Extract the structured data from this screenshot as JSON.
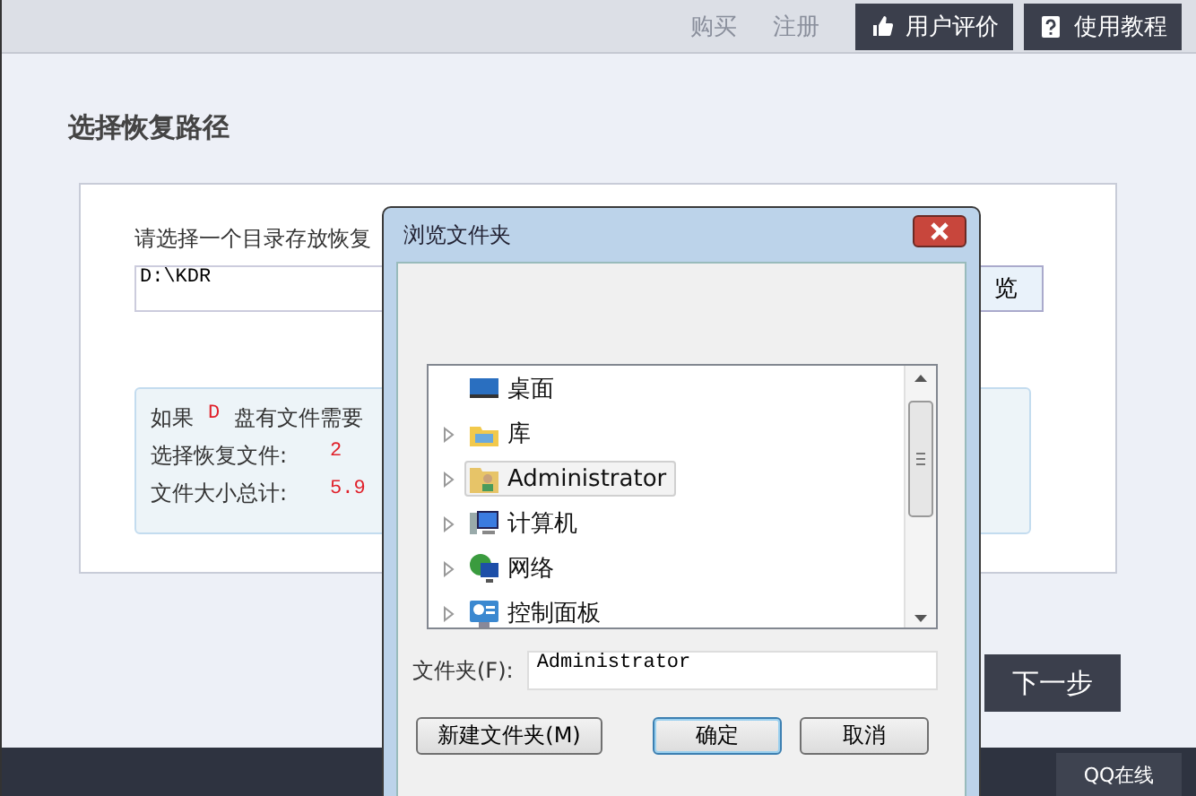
{
  "top_nav": {
    "links": [
      "购买",
      "注册"
    ],
    "buttons": [
      {
        "kind": "thumb",
        "label": "用户评价"
      },
      {
        "kind": "help",
        "label": "使用教程"
      }
    ]
  },
  "page": {
    "title": "选择恢复路径",
    "prompt": "请选择一个目录存放恢复",
    "path_value": "D:\\KDR",
    "browse_label": "览",
    "info": {
      "prefix": "如果",
      "drive": "D",
      "suffix": "盘有文件需要"
    },
    "rows": [
      {
        "label": "选择恢复文件:",
        "value": "2"
      },
      {
        "label": "文件大小总计:",
        "value": "5.9"
      }
    ],
    "next_button": "下一步",
    "qq_button": "QQ在线"
  },
  "dialog": {
    "title": "浏览文件夹",
    "tree": [
      {
        "kind": "desktop",
        "label": "桌面",
        "expandable": false,
        "selected": false
      },
      {
        "kind": "library",
        "label": "库",
        "expandable": true,
        "selected": false
      },
      {
        "kind": "user",
        "label": "Administrator",
        "expandable": true,
        "selected": true
      },
      {
        "kind": "computer",
        "label": "计算机",
        "expandable": true,
        "selected": false
      },
      {
        "kind": "network",
        "label": "网络",
        "expandable": true,
        "selected": false
      },
      {
        "kind": "control_panel",
        "label": "控制面板",
        "expandable": true,
        "selected": false
      }
    ],
    "folder_label": "文件夹(F):",
    "folder_value": "Administrator",
    "buttons": [
      {
        "label": "新建文件夹(M)",
        "default": false
      },
      {
        "label": "确定",
        "default": true
      },
      {
        "label": "取消",
        "default": false
      }
    ]
  }
}
